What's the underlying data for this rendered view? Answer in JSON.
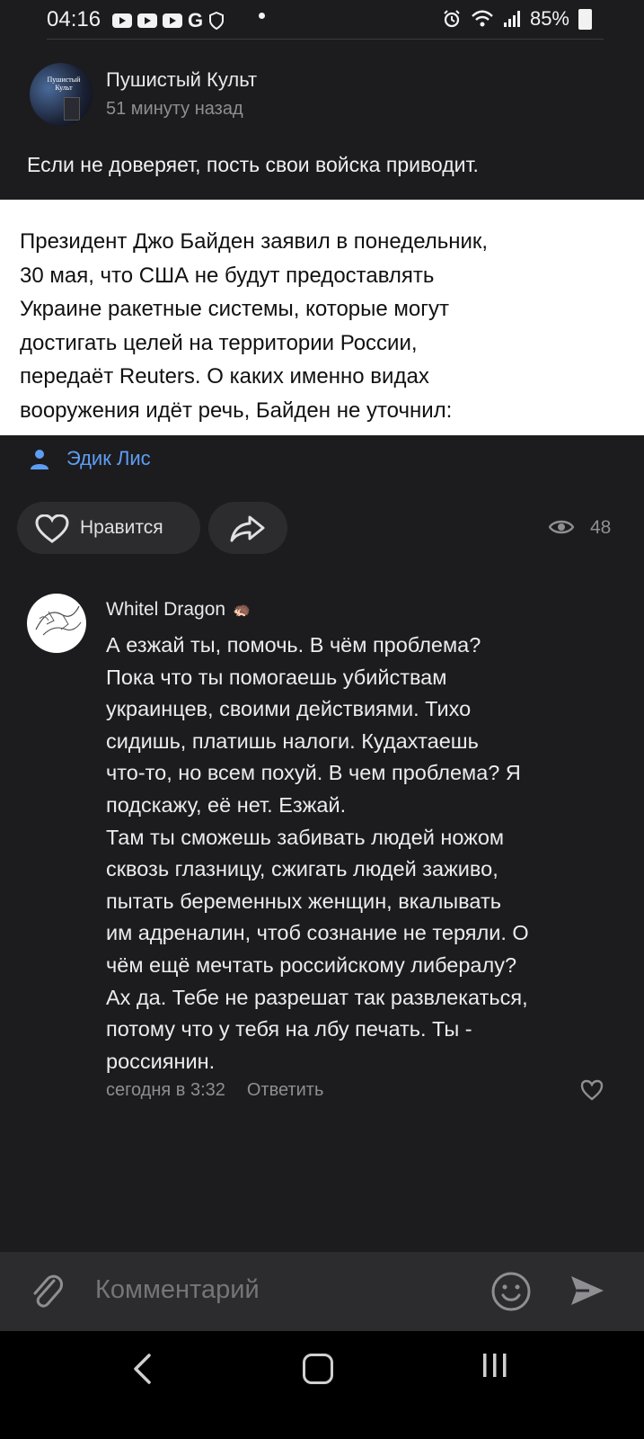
{
  "status_bar": {
    "time": "04:16",
    "battery": "85%",
    "g_label": "G"
  },
  "post": {
    "author": "Пушистый Культ",
    "avatar_text": "Пушистый Культ",
    "time_ago": "51 минуту назад",
    "text": "Если не доверяет, пость свои войска приводит.",
    "quote_lines": [
      "Президент Джо Байден заявил в понедельник,",
      "30 мая, что США не будут предоставлять",
      "Украине ракетные системы, которые могут",
      "достигать целей на территории России,",
      "передаёт Reuters. О каких именно видах",
      "вооружения идёт речь, Байден не уточнил:"
    ],
    "attribution": "Эдик Лис",
    "like_label": "Нравится",
    "views": "48"
  },
  "comment": {
    "author": "Whitel Dragon",
    "author_badge": "hedgehog-icon",
    "lines": [
      "А езжай ты, помочь. В чём проблема?",
      "Пока что ты помогаешь убийствам",
      "украинцев, своими действиями. Тихо",
      "сидишь, платишь налоги. Кудахтаешь",
      "что-то, но всем похуй. В чем проблема? Я",
      "подскажу, её нет. Езжай.",
      "Там ты сможешь забивать людей ножом",
      "сквозь глазницу, сжигать людей заживо,",
      "пытать беременных женщин, вкалывать",
      "им адреналин, чтоб сознание не теряли. О",
      "чём ещё мечтать российскому либералу?",
      "Ах да. Тебе не разрешат так развлекаться,",
      "потому что у тебя на лбу печать. Ты -",
      "россиянин."
    ],
    "timestamp": "сегодня в 3:32",
    "reply_label": "Ответить"
  },
  "composer": {
    "placeholder": "Комментарий"
  },
  "colors": {
    "background": "#1c1c1e",
    "link": "#5e9df5",
    "muted": "#8e8e93",
    "panel": "#2c2c2e"
  }
}
